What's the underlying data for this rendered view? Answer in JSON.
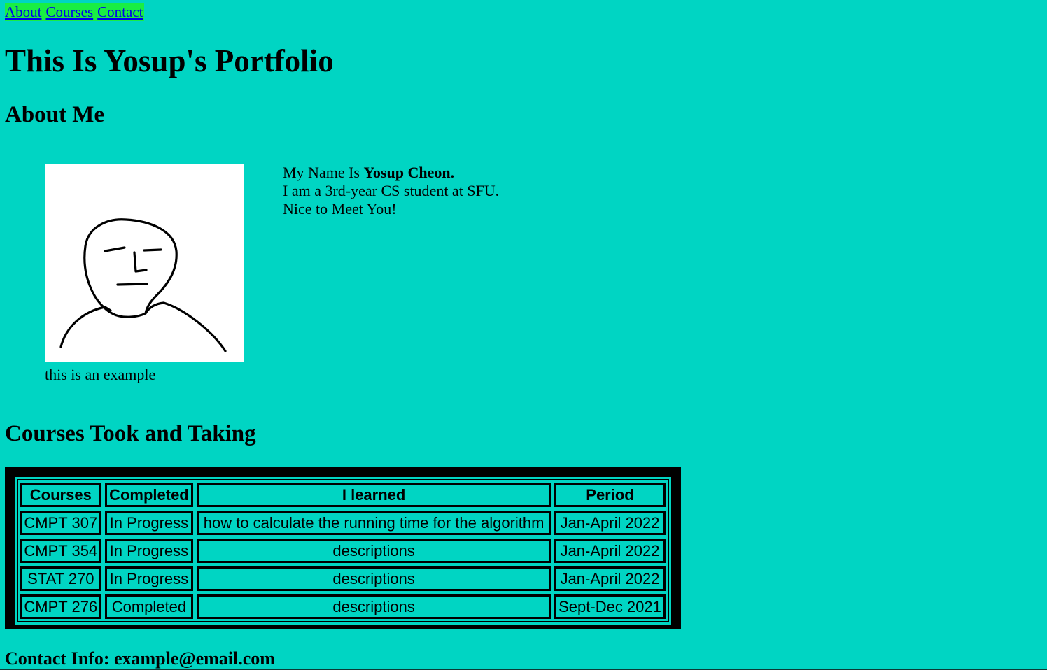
{
  "nav": {
    "items": [
      {
        "label": "About"
      },
      {
        "label": "Courses"
      },
      {
        "label": "Contact"
      }
    ]
  },
  "title": "This Is Yosup's Portfolio",
  "about": {
    "heading": "About Me",
    "figure_caption": "this is an example",
    "bio_prefix": "My Name Is ",
    "bio_name": "Yosup Cheon.",
    "bio_line2": "I am a 3rd-year CS student at SFU.",
    "bio_line3": "Nice to Meet You!"
  },
  "courses": {
    "heading": "Courses Took and Taking",
    "columns": [
      "Courses",
      "Completed",
      "I learned",
      "Period"
    ],
    "rows": [
      [
        "CMPT 307",
        "In Progress",
        "how to calculate the running time for the algorithm",
        "Jan-April 2022"
      ],
      [
        "CMPT 354",
        "In Progress",
        "descriptions",
        "Jan-April 2022"
      ],
      [
        "STAT 270",
        "In Progress",
        "descriptions",
        "Jan-April 2022"
      ],
      [
        "CMPT 276",
        "Completed",
        "descriptions",
        "Sept-Dec 2021"
      ]
    ]
  },
  "contact": {
    "text": "Contact Info: example@email.com"
  },
  "colors": {
    "page_background": "#00d5c3",
    "nav_background": "#19ee43",
    "link": "#0000ee"
  },
  "icons": {
    "avatar": "face-sketch-icon"
  }
}
